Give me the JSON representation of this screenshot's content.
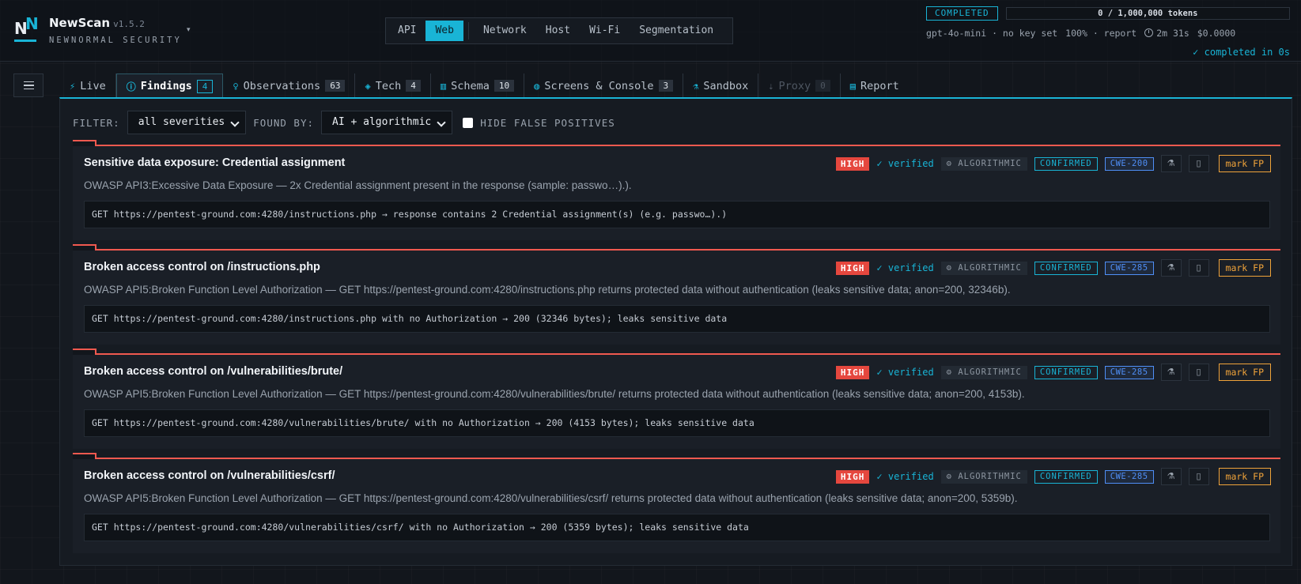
{
  "app": {
    "name": "NewScan",
    "version": "v1.5.2",
    "subtitle": "NEWNORMAL SECURITY",
    "logo": "NN",
    "caret": "▾"
  },
  "modes": [
    "API",
    "Web",
    "Network",
    "Host",
    "Wi-Fi",
    "Segmentation"
  ],
  "active_mode": "Web",
  "status": {
    "state": "COMPLETED",
    "tokens": "0 / 1,000,000 tokens",
    "model_line": "gpt-4o-mini · no key set",
    "progress": "100%",
    "stage": "· report",
    "duration": "2m 31s",
    "cost": "$0.0000",
    "completed": "✓ completed in 0s"
  },
  "tabs": [
    {
      "label": "Live",
      "icon": "⚡"
    },
    {
      "label": "Findings",
      "count": "4",
      "icon": "ⓘ"
    },
    {
      "label": "Observations",
      "count": "63",
      "icon": "♀"
    },
    {
      "label": "Tech",
      "count": "4",
      "icon": "◈"
    },
    {
      "label": "Schema",
      "count": "10",
      "icon": "▥"
    },
    {
      "label": "Screens & Console",
      "count": "3",
      "icon": "◍"
    },
    {
      "label": "Sandbox",
      "icon": "⚗"
    },
    {
      "label": "Proxy",
      "count": "0",
      "icon": "⇣"
    },
    {
      "label": "Report",
      "icon": "▤"
    }
  ],
  "filter": {
    "filter_label": "FILTER:",
    "severity": "all severities",
    "found_by_label": "FOUND BY:",
    "found_by": "AI + algorithmic",
    "hide_fp_label": "HIDE FALSE POSITIVES"
  },
  "badges": {
    "high": "HIGH",
    "verified": "✓ verified",
    "algorithmic": "⚙ ALGORITHMIC",
    "confirmed": "CONFIRMED",
    "mark_fp": "mark FP"
  },
  "findings": [
    {
      "title": "Sensitive data exposure: Credential assignment",
      "cwe": "CWE-200",
      "description": "OWASP API3:Excessive Data Exposure — 2x Credential assignment present in the response (sample: passwo…).).",
      "evidence": "GET https://pentest-ground.com:4280/instructions.php → response contains 2 Credential assignment(s) (e.g. passwo…).)"
    },
    {
      "title": "Broken access control on /instructions.php",
      "cwe": "CWE-285",
      "description": "OWASP API5:Broken Function Level Authorization — GET https://pentest-ground.com:4280/instructions.php returns protected data without authentication (leaks sensitive data; anon=200, 32346b).",
      "evidence": "GET https://pentest-ground.com:4280/instructions.php with no Authorization → 200 (32346 bytes); leaks sensitive data"
    },
    {
      "title": "Broken access control on /vulnerabilities/brute/",
      "cwe": "CWE-285",
      "description": "OWASP API5:Broken Function Level Authorization — GET https://pentest-ground.com:4280/vulnerabilities/brute/ returns protected data without authentication (leaks sensitive data; anon=200, 4153b).",
      "evidence": "GET https://pentest-ground.com:4280/vulnerabilities/brute/ with no Authorization → 200 (4153 bytes); leaks sensitive data"
    },
    {
      "title": "Broken access control on /vulnerabilities/csrf/",
      "cwe": "CWE-285",
      "description": "OWASP API5:Broken Function Level Authorization — GET https://pentest-ground.com:4280/vulnerabilities/csrf/ returns protected data without authentication (leaks sensitive data; anon=200, 5359b).",
      "evidence": "GET https://pentest-ground.com:4280/vulnerabilities/csrf/ with no Authorization → 200 (5359 bytes); leaks sensitive data"
    }
  ],
  "colors": {
    "accent": "#19b4d6",
    "high": "#e5473e",
    "cwe": "#4f8ff7",
    "fp": "#f0a33a",
    "bg": "#12161c"
  }
}
